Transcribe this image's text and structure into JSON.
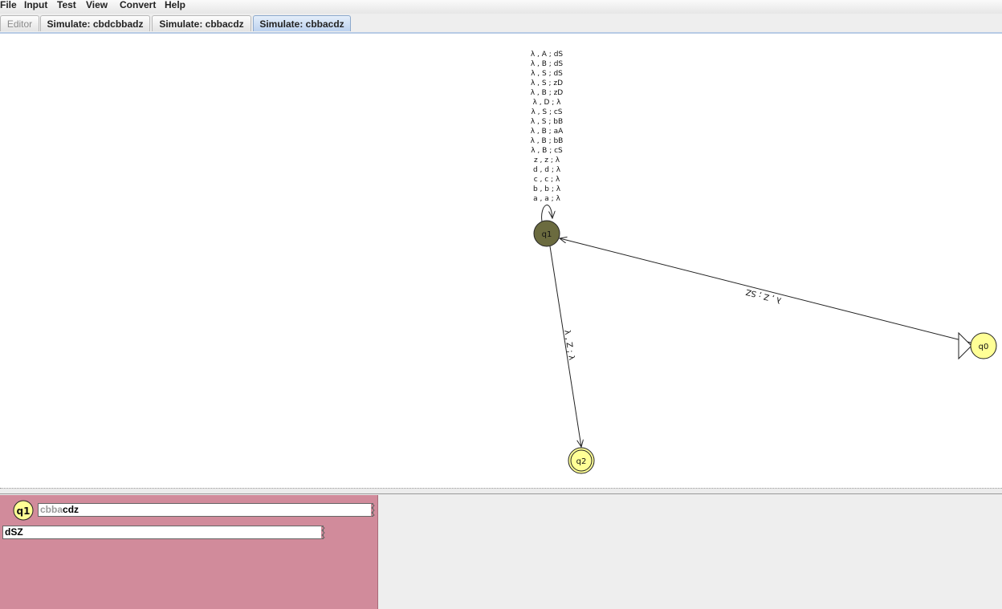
{
  "menu": {
    "items": [
      {
        "label": "File"
      },
      {
        "label": "Input"
      },
      {
        "label": "Test"
      },
      {
        "label": "View"
      },
      {
        "label": "Convert"
      },
      {
        "label": "Help"
      }
    ]
  },
  "tabs": [
    {
      "label": "Editor",
      "state": "disabled"
    },
    {
      "label": "Simulate: cbdcbbadz",
      "state": "normal"
    },
    {
      "label": "Simulate: cbbacdz",
      "state": "normal"
    },
    {
      "label": "Simulate: cbbacdz",
      "state": "selected"
    }
  ],
  "automaton": {
    "states": [
      {
        "id": "q1",
        "label": "q1",
        "current": true,
        "initial": false,
        "final": false
      },
      {
        "id": "q0",
        "label": "q0",
        "current": false,
        "initial": true,
        "final": false
      },
      {
        "id": "q2",
        "label": "q2",
        "current": false,
        "initial": false,
        "final": true
      }
    ],
    "self_loop_labels": [
      "λ , A ; dS",
      "λ , B ; dS",
      "λ , S ; dS",
      "λ , S ; zD",
      "λ , B ; zD",
      "λ , D ; λ",
      "λ , S ; cS",
      "λ , S ; bB",
      "λ , B ; aA",
      "λ , B ; bB",
      "λ , B ; cS",
      "z , z ; λ",
      "d , d ; λ",
      "c , c ; λ",
      "b , b ; λ",
      "a , a ; λ"
    ],
    "transitions": [
      {
        "from": "q0",
        "to": "q1",
        "label": "λ , Z ; SZ"
      },
      {
        "from": "q1",
        "to": "q2",
        "label": "λ , Z ; λ"
      }
    ]
  },
  "configuration": {
    "state": "q1",
    "input_consumed": "cbba",
    "input_remaining": "cdz",
    "stack": "dSZ"
  },
  "colors": {
    "state_fill": "#ffff96",
    "current_state_fill": "#6b6b3f",
    "config_panel_bg": "#d18b9b",
    "selected_tab": "#bcd2ef"
  }
}
